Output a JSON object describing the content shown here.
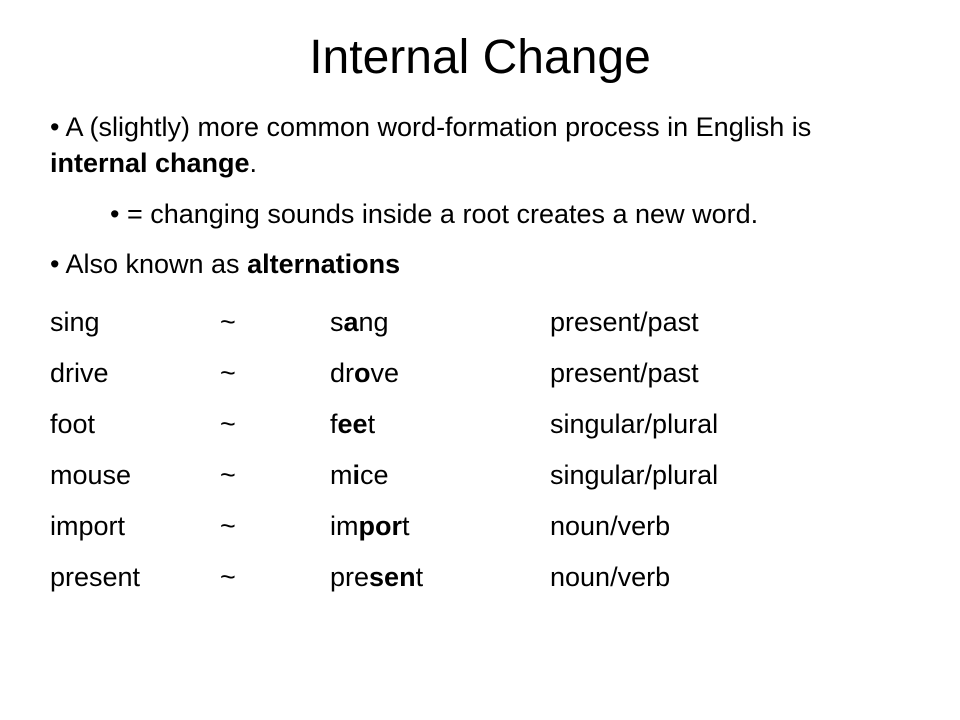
{
  "title": "Internal Change",
  "bullets": {
    "b1_pre": "• A (slightly) more common word-formation process in English is ",
    "b1_bold": "internal change",
    "b1_post": ".",
    "b2": "• = changing sounds inside a root creates a new word.",
    "b3_pre": "• Also known as ",
    "b3_bold": "alternations"
  },
  "tilde": "~",
  "rows": [
    {
      "base": "sing",
      "pre": "s",
      "em": "a",
      "post": "ng",
      "gloss": "present/past"
    },
    {
      "base": "drive",
      "pre": "dr",
      "em": "o",
      "post": "ve",
      "gloss": "present/past"
    },
    {
      "base": "foot",
      "pre": "f",
      "em": "ee",
      "post": "t",
      "gloss": "singular/plural"
    },
    {
      "base": "mouse",
      "pre": "m",
      "em": "i",
      "post": "ce",
      "gloss": "singular/plural"
    },
    {
      "base": "import",
      "pre": "im",
      "em": "por",
      "post": "t",
      "gloss": "noun/verb"
    },
    {
      "base": "present",
      "pre": "pre",
      "em": "sen",
      "post": "t",
      "gloss": "noun/verb"
    }
  ]
}
